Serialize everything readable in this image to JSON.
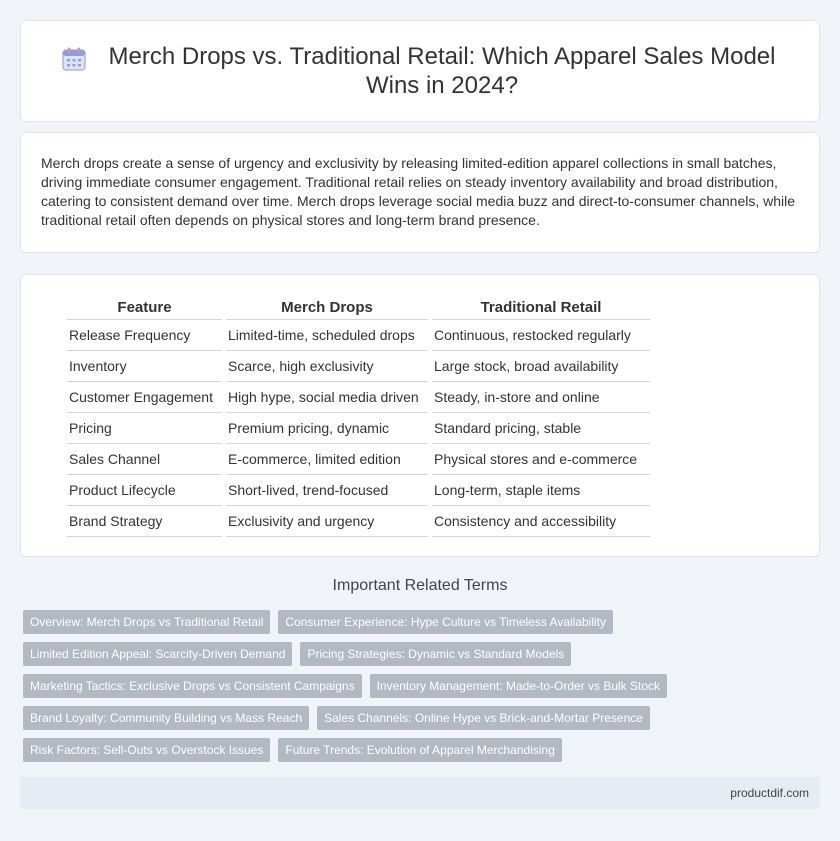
{
  "header": {
    "title": "Merch Drops vs. Traditional Retail: Which Apparel Sales Model Wins in 2024?",
    "icon": "calendar-icon"
  },
  "intro": {
    "text": "Merch drops create a sense of urgency and exclusivity by releasing limited-edition apparel collections in small batches, driving immediate consumer engagement. Traditional retail relies on steady inventory availability and broad distribution, catering to consistent demand over time. Merch drops leverage social media buzz and direct-to-consumer channels, while traditional retail often depends on physical stores and long-term brand presence."
  },
  "table": {
    "headers": [
      "Feature",
      "Merch Drops",
      "Traditional Retail"
    ],
    "rows": [
      [
        "Release Frequency",
        "Limited-time, scheduled drops",
        "Continuous, restocked regularly"
      ],
      [
        "Inventory",
        "Scarce, high exclusivity",
        "Large stock, broad availability"
      ],
      [
        "Customer Engagement",
        "High hype, social media driven",
        "Steady, in-store and online"
      ],
      [
        "Pricing",
        "Premium pricing, dynamic",
        "Standard pricing, stable"
      ],
      [
        "Sales Channel",
        "E-commerce, limited edition",
        "Physical stores and e-commerce"
      ],
      [
        "Product Lifecycle",
        "Short-lived, trend-focused",
        "Long-term, staple items"
      ],
      [
        "Brand Strategy",
        "Exclusivity and urgency",
        "Consistency and accessibility"
      ]
    ]
  },
  "related": {
    "title": "Important Related Terms",
    "rows": [
      [
        "Overview: Merch Drops vs Traditional Retail",
        "Consumer Experience: Hype Culture vs Timeless Availability"
      ],
      [
        "Limited Edition Appeal: Scarcity-Driven Demand",
        "Pricing Strategies: Dynamic vs Standard Models"
      ],
      [
        "Marketing Tactics: Exclusive Drops vs Consistent Campaigns",
        "Inventory Management: Made-to-Order vs Bulk Stock"
      ],
      [
        "Brand Loyalty: Community Building vs Mass Reach",
        "Sales Channels: Online Hype vs Brick-and-Mortar Presence"
      ],
      [
        "Risk Factors: Sell-Outs vs Overstock Issues",
        "Future Trends: Evolution of Apparel Merchandising"
      ]
    ]
  },
  "footer": {
    "site": "productdif.com"
  }
}
